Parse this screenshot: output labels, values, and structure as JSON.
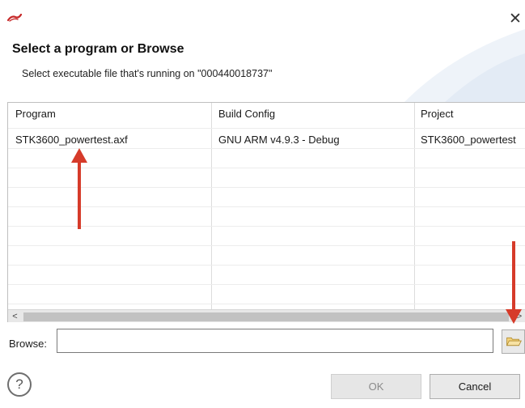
{
  "dialog": {
    "header_title": "Select a program or Browse",
    "header_description": "Select executable file that's running on \"000440018737\"",
    "close_glyph": "✕"
  },
  "table": {
    "columns": [
      "Program",
      "Build Config",
      "Project"
    ],
    "rows": [
      [
        "STK3600_powertest.axf",
        "GNU ARM v4.9.3 - Debug",
        "STK3600_powertest"
      ]
    ]
  },
  "scrollbar": {
    "left_arrow": "<",
    "right_arrow": ">"
  },
  "browse": {
    "label": "Browse:",
    "value": "",
    "button_icon": "folder-open-icon"
  },
  "footer": {
    "help_glyph": "?",
    "ok_label": "OK",
    "cancel_label": "Cancel"
  },
  "colors": {
    "annotation_arrow": "#d63b2a",
    "folder_icon": "#e9b84a",
    "header_art": "#e3ebf5"
  }
}
